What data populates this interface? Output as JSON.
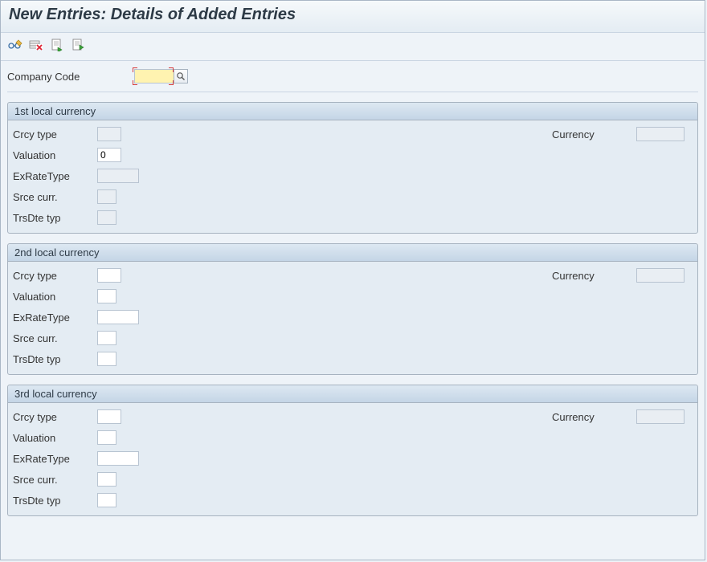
{
  "title": "New Entries: Details of Added Entries",
  "toolbar": {
    "icons": [
      "glasses-pencil-icon",
      "delete-row-icon",
      "prev-entry-icon",
      "next-entry-icon"
    ]
  },
  "header": {
    "companyCodeLabel": "Company Code",
    "companyCodeValue": ""
  },
  "groups": [
    {
      "title": "1st local currency",
      "fields": {
        "crcyTypeLabel": "Crcy type",
        "crcyTypeValue": "",
        "currencyLabel": "Currency",
        "currencyValue": "",
        "valuationLabel": "Valuation",
        "valuationValue": "0",
        "exRateTypeLabel": "ExRateType",
        "exRateTypeValue": "",
        "srceCurrLabel": "Srce curr.",
        "srceCurrValue": "",
        "trsDteTypLabel": "TrsDte typ",
        "trsDteTypValue": ""
      },
      "readonly": true,
      "valuationReadonly": false
    },
    {
      "title": "2nd local currency",
      "fields": {
        "crcyTypeLabel": "Crcy type",
        "crcyTypeValue": "",
        "currencyLabel": "Currency",
        "currencyValue": "",
        "valuationLabel": "Valuation",
        "valuationValue": "",
        "exRateTypeLabel": "ExRateType",
        "exRateTypeValue": "",
        "srceCurrLabel": "Srce curr.",
        "srceCurrValue": "",
        "trsDteTypLabel": "TrsDte typ",
        "trsDteTypValue": ""
      },
      "readonly": false
    },
    {
      "title": "3rd local currency",
      "fields": {
        "crcyTypeLabel": "Crcy type",
        "crcyTypeValue": "",
        "currencyLabel": "Currency",
        "currencyValue": "",
        "valuationLabel": "Valuation",
        "valuationValue": "",
        "exRateTypeLabel": "ExRateType",
        "exRateTypeValue": "",
        "srceCurrLabel": "Srce curr.",
        "srceCurrValue": "",
        "trsDteTypLabel": "TrsDte typ",
        "trsDteTypValue": ""
      },
      "readonly": false
    }
  ]
}
